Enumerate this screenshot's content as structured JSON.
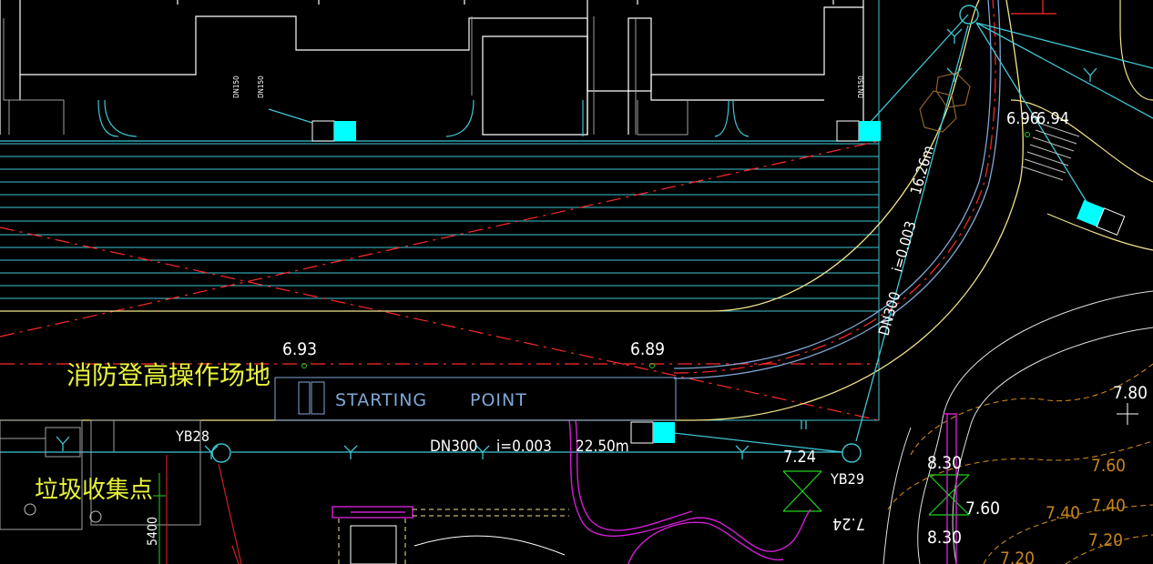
{
  "colors": {
    "background": "#000000",
    "cyan": "#00FFFF",
    "building": "#FFFFFF",
    "pipe": "#3EC6D4",
    "road_yellow": "#F2E58A",
    "red_dash": "#FF2A2A",
    "magenta": "#D21FD2",
    "green": "#1FD21F",
    "contour": "#C8841E",
    "chinese_label": "#E8F23A",
    "text_white": "#FFFFFF",
    "starting_point": "#7FA7D6"
  },
  "labels": {
    "fire_area": "消防登高操作场地",
    "garbage_point": "垃圾收集点",
    "starting": "STARTING",
    "point": "POINT",
    "yb28": "YB28",
    "yb29": "YB29",
    "pipe_bottom_dn": "DN300",
    "pipe_bottom_slope": "i=0.003",
    "pipe_bottom_len": "22.50m",
    "pipe_diag_dn": "DN300",
    "pipe_diag_slope": "i=0.003",
    "pipe_diag_len": "16.26m",
    "dn150_a": "DN150",
    "dn150_b": "DN150",
    "dn150_c": "DN150",
    "dim_5400": "5400"
  },
  "elevations": {
    "e693": "6.93",
    "e689": "6.89",
    "e696": "6.96",
    "e694": "6.94",
    "e724a": "7.24",
    "e724b": "7.24",
    "e780": "7.80",
    "e760a": "7.60",
    "e760b": "7.60",
    "e740a": "7.40",
    "e740b": "7.40",
    "e720a": "7.20",
    "e720b": "7.20",
    "e830a": "8.30",
    "e830b": "8.30"
  }
}
